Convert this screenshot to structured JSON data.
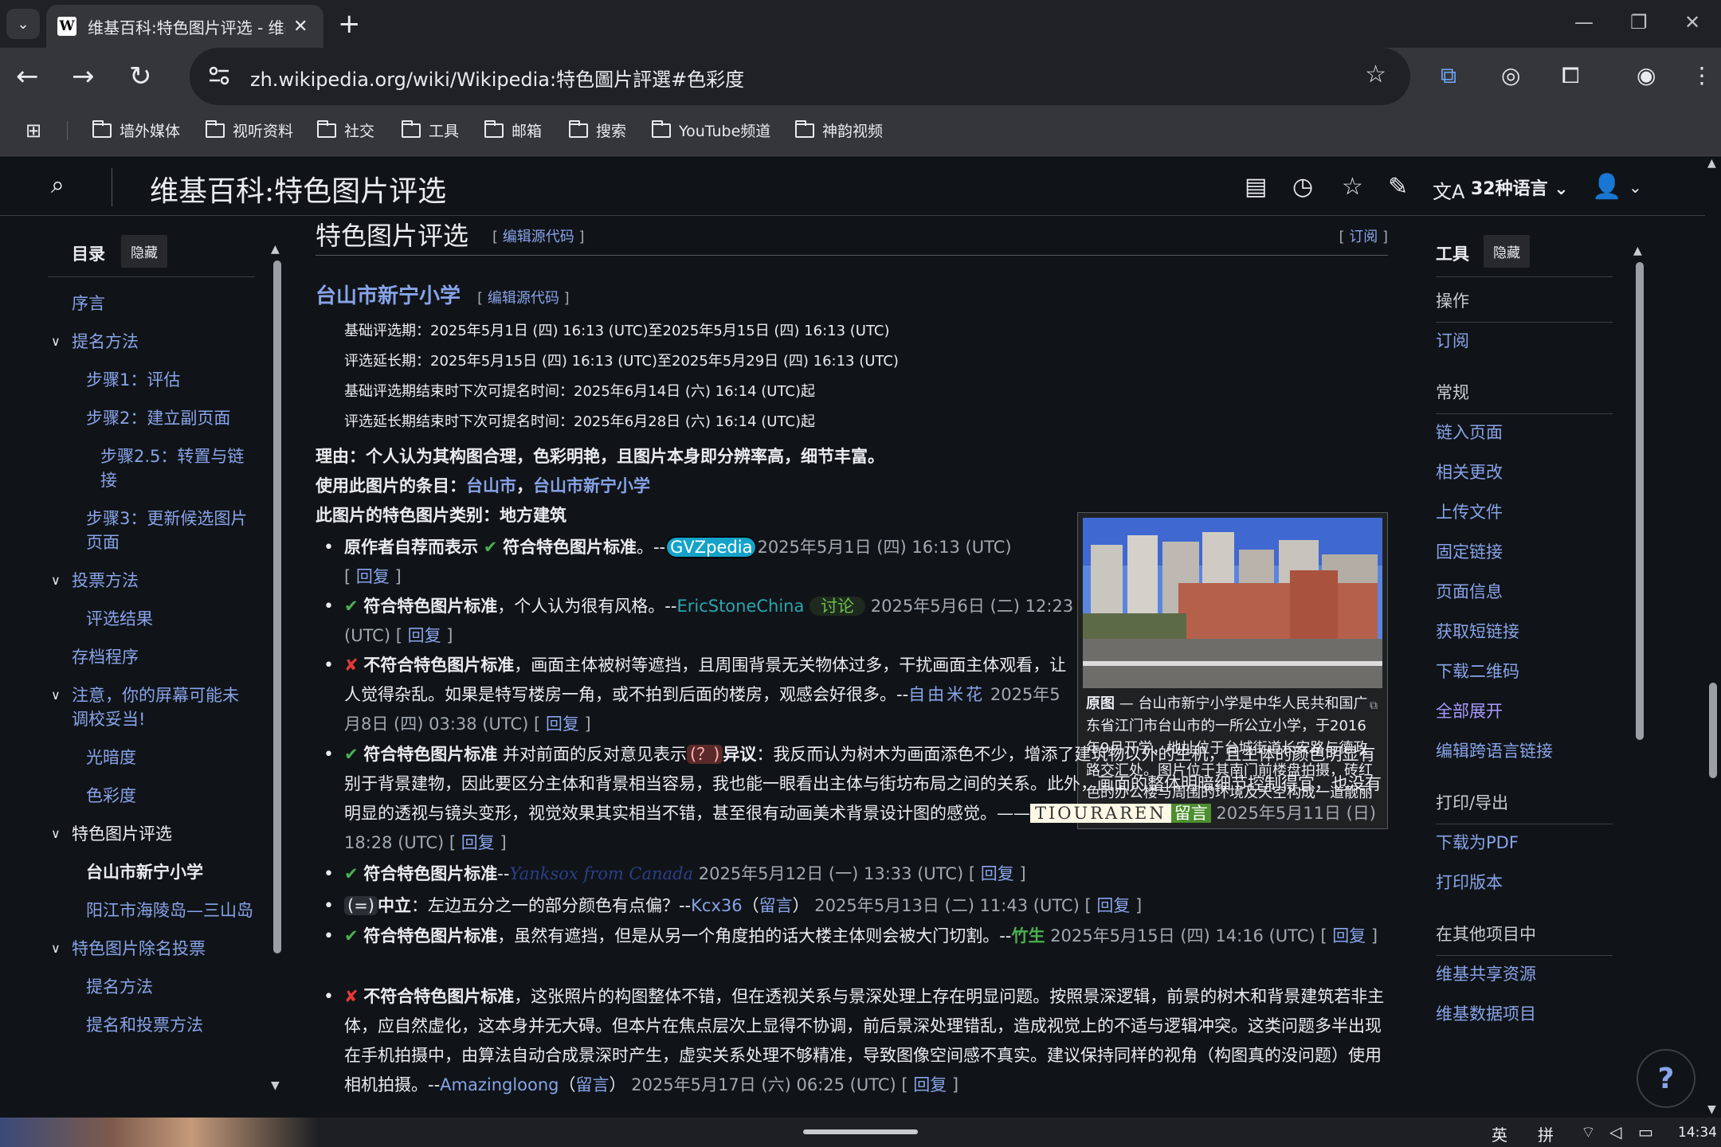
{
  "browser": {
    "tab_title": "维基百科:特色图片评选 - 维基",
    "tab_favicon": "W",
    "url": "zh.wikipedia.org/wiki/Wikipedia:特色圖片評選#色彩度",
    "bookmarks": [
      "墙外媒体",
      "视听资料",
      "社交",
      "工具",
      "邮箱",
      "搜索",
      "YouTube频道",
      "神韵视频"
    ]
  },
  "header": {
    "title": "维基百科:特色图片评选",
    "languages": "32种语言"
  },
  "toc": {
    "title": "目录",
    "hide": "隐藏",
    "items": [
      {
        "label": "序言",
        "level": 1
      },
      {
        "label": "提名方法",
        "level": 1,
        "caret": "∨"
      },
      {
        "label": "步骤1：评估",
        "level": 2
      },
      {
        "label": "步骤2：建立副页面",
        "level": 2
      },
      {
        "label": "步骤2.5：转置与链接",
        "level": 3
      },
      {
        "label": "步骤3：更新候选图片页面",
        "level": 2
      },
      {
        "label": "投票方法",
        "level": 1,
        "caret": "∨"
      },
      {
        "label": "评选结果",
        "level": 2
      },
      {
        "label": "存档程序",
        "level": 1
      },
      {
        "label": "注意，你的屏幕可能未调校妥当!",
        "level": 1,
        "caret": "∨"
      },
      {
        "label": "光暗度",
        "level": 2
      },
      {
        "label": "色彩度",
        "level": 2
      },
      {
        "label": "特色图片评选",
        "level": 1,
        "caret": "∨",
        "current": true
      },
      {
        "label": "台山市新宁小学",
        "level": 2,
        "current": true
      },
      {
        "label": "阳江市海陵岛—三山岛",
        "level": 2
      },
      {
        "label": "特色图片除名投票",
        "level": 1,
        "caret": "∨"
      },
      {
        "label": "提名方法",
        "level": 2
      },
      {
        "label": "提名和投票方法",
        "level": 2
      }
    ]
  },
  "tools": {
    "title": "工具",
    "hide": "隐藏",
    "groups": [
      {
        "section": "操作",
        "items": [
          "订阅"
        ]
      },
      {
        "section": "常规",
        "items": [
          "链入页面",
          "相关更改",
          "上传文件",
          "固定链接",
          "页面信息",
          "获取短链接",
          "下载二维码",
          "全部展开",
          "编辑跨语言链接"
        ]
      },
      {
        "section": "打印/导出",
        "items": [
          "下载为PDF",
          "打印版本"
        ]
      },
      {
        "section": "在其他项目中",
        "items": [
          "维基共享资源",
          "维基数据项目"
        ]
      }
    ]
  },
  "content": {
    "h2": "特色图片评选",
    "h2_edit": "编辑源代码",
    "h2_subscribe": "订阅",
    "h3": "台山市新宁小学",
    "h3_edit": "编辑源代码",
    "periods": [
      "基础评选期：2025年5月1日 (四) 16:13 (UTC)至2025年5月15日 (四) 16:13 (UTC)",
      "评选延长期：2025年5月15日 (四) 16:13 (UTC)至2025年5月29日 (四) 16:13 (UTC)",
      "基础评选期结束时下次可提名时间：2025年6月14日 (六) 16:14 (UTC)起",
      "评选延长期结束时下次可提名时间：2025年6月28日 (六) 16:14 (UTC)起"
    ],
    "reason": "理由：个人认为其构图合理，色彩明艳，且图片本身即分辨率高，细节丰富。",
    "used_in_label": "使用此图片的条目：",
    "used_in_links": [
      "台山市",
      "台山市新宁小学"
    ],
    "category": "此图片的特色图片类别：地方建筑",
    "thumb_caption_bold": "原图",
    "thumb_caption": " — 台山市新宁小学是中华人民共和国广东省江门市台山市的一所公立小学，于2016年9月开学，地址位于台城街道长安路与德政路交汇处。图片位于其南门前楼盘拍摄，砖红色的办公楼与周围的环境及天空构成一道靓丽的风景。",
    "votes": {
      "v1": {
        "a": "原作者自荐而表示",
        "b": "符合特色图片标准",
        "c": "。--",
        "user": "GVZpedia",
        "time": "2025年5月1日 (四) 16:13 (UTC)",
        "reply": "回复"
      },
      "v2": {
        "b": "符合特色图片标准",
        "c": "，个人认为很有风格。--",
        "user": "EricStoneChina",
        "talk": "讨论",
        "time": "2025年5月6日 (二) 12:23 (UTC)",
        "reply": "回复"
      },
      "v3": {
        "b": "不符合特色图片标准",
        "c": "，画面主体被树等遮挡，且周围背景无关物体过多，干扰画面主体观看，让人觉得杂乱。如果是特写楼房一角，或不拍到后面的楼房，观感会好很多。--",
        "user": "自由米花",
        "time": "2025年5月8日 (四) 03:38 (UTC)",
        "reply": "回复"
      },
      "v4": {
        "b": "符合特色图片标准",
        "c": "并对前面的反对意见表示",
        "q": "(？)",
        "d": "异议",
        "e": "：我反而认为树木为画面添色不少，增添了建筑物以外的生机，且主体的颜色明显有别于背景建物，因此要区分主体和背景相当容易，我也能一眼看出主体与街坊布局之间的关系。此外，画面的整体明暗细节控制得宜，也没有明显的透视与镜头变形，视觉效果其实相当不错，甚至很有动画美术背景设计图的感觉。——",
        "user": "TIOURAREN",
        "talk": "留言",
        "time": "2025年5月11日 (日) 18:28 (UTC)",
        "reply": "回复"
      },
      "v5": {
        "b": "符合特色图片标准",
        "c": "--",
        "user": "Yanksox from Canada",
        "time": "2025年5月12日 (一) 13:33 (UTC)",
        "reply": "回复"
      },
      "v6": {
        "q": "(=)",
        "b": "中立",
        "c": "：左边五分之一的部分颜色有点偏？--",
        "user": "Kcx36",
        "talk": "留言",
        "time": "2025年5月13日 (二) 11:43 (UTC)",
        "reply": "回复"
      },
      "v7": {
        "b": "符合特色图片标准",
        "c": "，虽然有遮挡，但是从另一个角度拍的话大楼主体则会被大门切割。--",
        "user": "竹生",
        "time": "2025年5月15日 (四) 14:16 (UTC)",
        "reply": "回复"
      },
      "v8": {
        "b": "不符合特色图片标准",
        "c": "，这张照片的构图整体不错，但在透视关系与景深处理上存在明显问题。按照景深逻辑，前景的树木和背景建筑若非主体，应自然虚化，这本身并无大碍。但本片在焦点层次上显得不协调，前后景深处理错乱，造成视觉上的不适与逻辑冲突。这类问题多半出现在手机拍摄中，由算法自动合成景深时产生，虚实关系处理不够精准，导致图像空间感不真实。建议保持同样的视角（构图真的没问题）使用相机拍摄。--",
        "user": "Amazingloong",
        "talk": "留言",
        "time": "2025年5月17日 (六) 06:25 (UTC)",
        "reply": "回复"
      }
    }
  },
  "help": "?",
  "taskbar": {
    "ime1": "英",
    "ime2": "拼",
    "time": "14:34"
  }
}
